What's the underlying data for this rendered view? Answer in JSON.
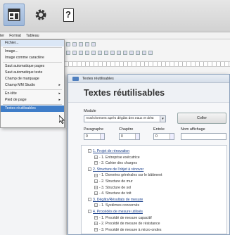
{
  "toolbar": {
    "icons": [
      "layout-icon",
      "gear-icon",
      "help-icon"
    ],
    "help_glyph": "?"
  },
  "menubar": {
    "items": [
      "ter",
      "Format",
      "Tableau"
    ]
  },
  "menu": {
    "items": [
      {
        "label": "Fichier...",
        "arrow": false
      },
      {
        "label": "Image...",
        "arrow": false
      },
      {
        "label": "Image comme caractère",
        "arrow": false
      },
      {
        "label": "Saut automatique pages",
        "arrow": false
      },
      {
        "label": "Saut automatique texte",
        "arrow": false
      },
      {
        "label": "Champ de marquage",
        "arrow": false
      },
      {
        "label": "Champ MM Studio",
        "arrow": true
      },
      {
        "label": "En-tête",
        "arrow": true
      },
      {
        "label": "Pied de page",
        "arrow": true
      },
      {
        "label": "Textes réutilisables",
        "arrow": false
      }
    ],
    "arrow_glyph": "▸"
  },
  "dialog": {
    "window_title": "Textes réutilisables",
    "heading": "Textes réutilisables",
    "module_label": "Module",
    "module_value": "Assèchement après dégâts des eaux et dést",
    "caret": "▾",
    "button_label": "Coller",
    "fields": [
      {
        "label": "Paragraphe",
        "value": "0"
      },
      {
        "label": "Chapitre",
        "value": "0"
      },
      {
        "label": "Entrée",
        "value": "0"
      },
      {
        "label": "Nom affichage",
        "value": ""
      }
    ],
    "tree": [
      {
        "level": 0,
        "toggle": "-",
        "text": "1. Projet de rénovation"
      },
      {
        "level": 1,
        "toggle": "+",
        "text": "- 1. Entreprise exécutrice"
      },
      {
        "level": 1,
        "toggle": "+",
        "text": "- 2. Cahier des charges"
      },
      {
        "level": 0,
        "toggle": "-",
        "text": "2. Structure de l'objet à rénover"
      },
      {
        "level": 1,
        "toggle": "+",
        "text": "- 1. Données générales sur le bâtiment"
      },
      {
        "level": 1,
        "toggle": "+",
        "text": "- 2. Structure de mur"
      },
      {
        "level": 1,
        "toggle": "+",
        "text": "- 3. Structure de sol"
      },
      {
        "level": 1,
        "toggle": "+",
        "text": "- 4. Structure de toit"
      },
      {
        "level": 0,
        "toggle": "-",
        "text": "3. Dégâts/Résultats de mesure"
      },
      {
        "level": 1,
        "toggle": "+",
        "text": "- 1. Systèmes concernés"
      },
      {
        "level": 0,
        "toggle": "-",
        "text": "4. Procédés de mesure utilisés"
      },
      {
        "level": 1,
        "toggle": "+",
        "text": "- 1. Procédé de mesure capacitif"
      },
      {
        "level": 1,
        "toggle": "+",
        "text": "- 2. Procédé de mesure de résistance"
      },
      {
        "level": 1,
        "toggle": "+",
        "text": "- 3. Procédé de mesure à micro-ondes"
      }
    ]
  },
  "colors": {
    "selected_menu": "#3f7dc8",
    "link": "#1a3f8a"
  }
}
